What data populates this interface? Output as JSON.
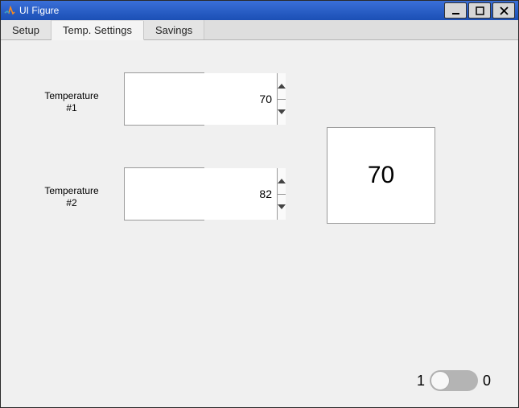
{
  "window": {
    "title": "UI Figure"
  },
  "tabs": [
    {
      "label": "Setup",
      "active": false
    },
    {
      "label": "Temp. Settings",
      "active": true
    },
    {
      "label": "Savings",
      "active": false
    }
  ],
  "temp1": {
    "label_line1": "Temperature",
    "label_line2": "#1",
    "value": "70"
  },
  "temp2": {
    "label_line1": "Temperature",
    "label_line2": "#2",
    "value": "82"
  },
  "display": {
    "value": "70"
  },
  "switch": {
    "left_label": "1",
    "right_label": "0",
    "state": "0"
  }
}
